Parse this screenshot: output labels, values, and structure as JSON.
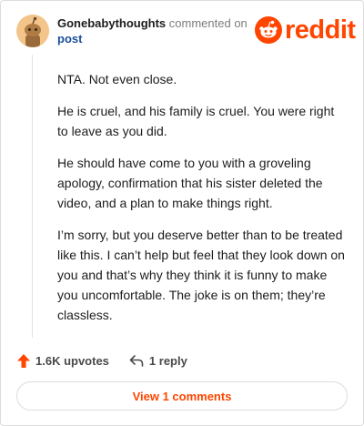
{
  "comment": {
    "username": "Gonebabythoughts",
    "action_text": "commented on",
    "post_link": "post",
    "paragraphs": [
      "NTA. Not even close.",
      "He is cruel, and his family is cruel. You were right to leave as you did.",
      "He should have come to you with a groveling apology, confirmation that his sister deleted the video, and a plan to make things right.",
      "I’m sorry, but you deserve better than to be treated like this. I can’t help but feel that they look down on you and that’s why they think it is funny to make you uncomfortable. The joke is on them; they’re classless."
    ]
  },
  "brand": {
    "logo_text": "reddit",
    "color": "#ff4500"
  },
  "actions": {
    "upvotes": "1.6K upvotes",
    "replies": "1 reply",
    "upvote_icon": "arrow-up-icon",
    "reply_icon": "reply-arrow-icon"
  },
  "view_button": {
    "label": "View 1 comments"
  }
}
